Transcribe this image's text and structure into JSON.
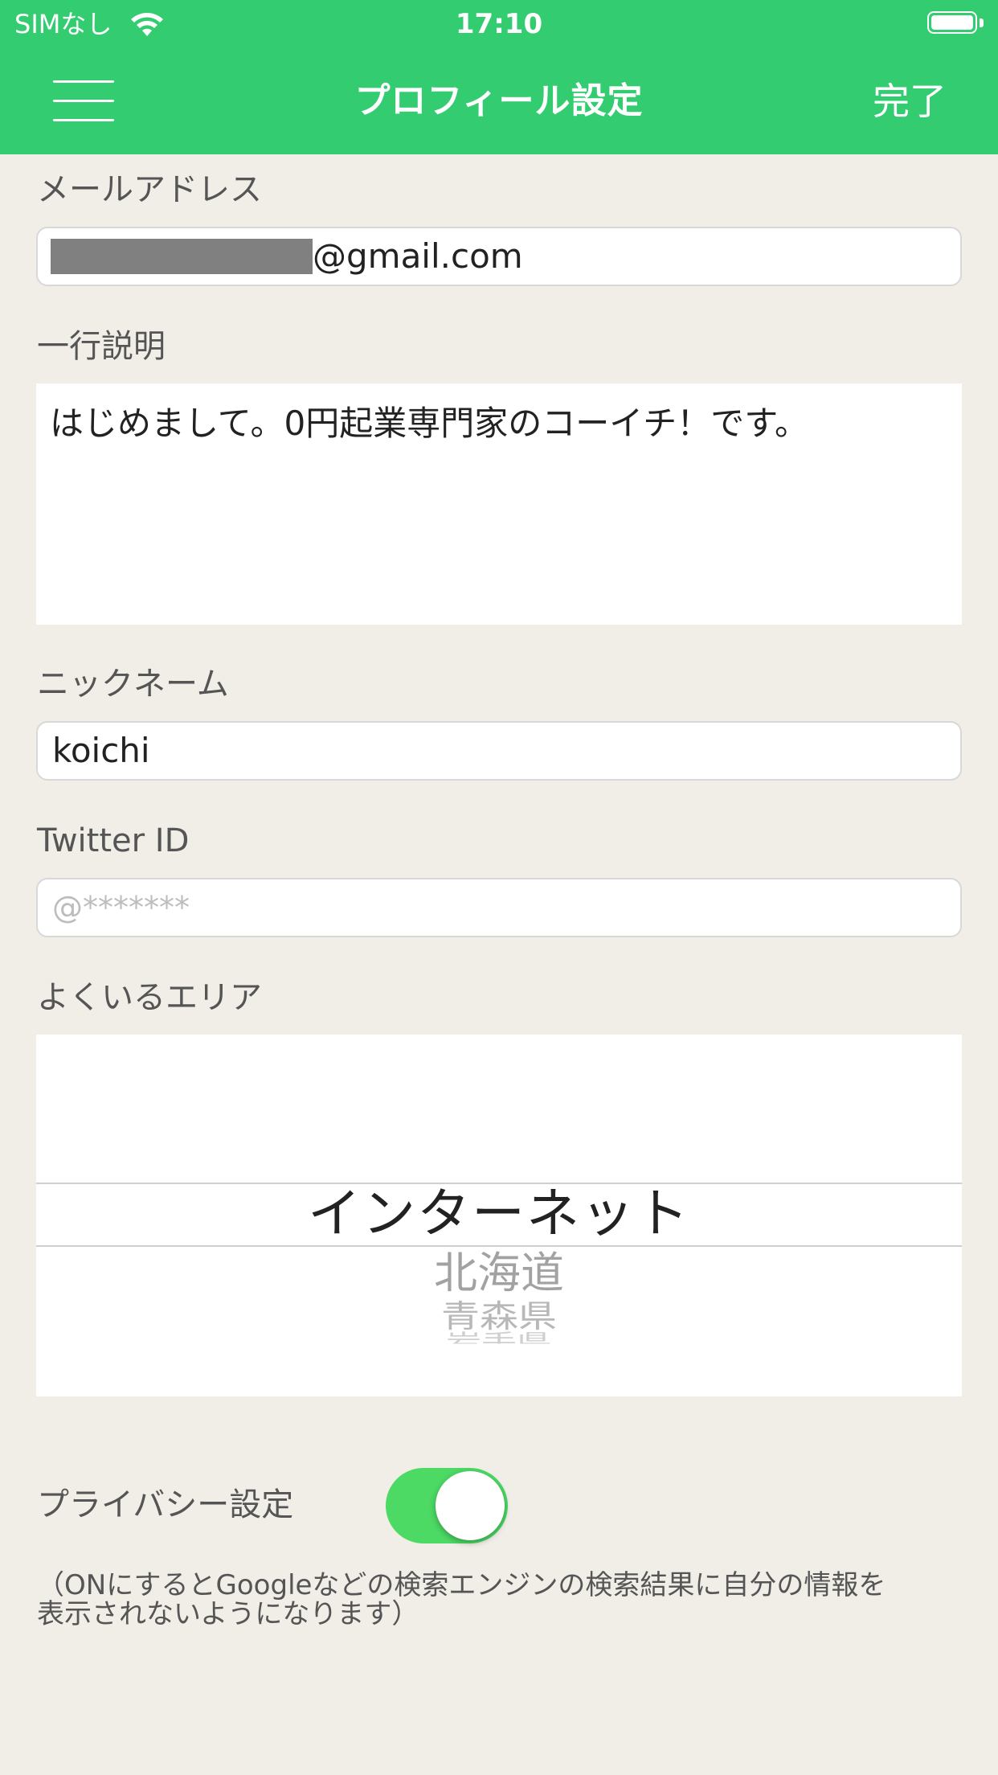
{
  "status_bar": {
    "carrier": "SIMなし",
    "time": "17:10"
  },
  "nav": {
    "title": "プロフィール設定",
    "done_label": "完了"
  },
  "form": {
    "email": {
      "label": "メールアドレス",
      "value_suffix": "@gmail.com"
    },
    "description": {
      "label": "一行説明",
      "value": "はじめまして。0円起業専門家のコーイチ！です。"
    },
    "nickname": {
      "label": "ニックネーム",
      "value": "koichi"
    },
    "twitter": {
      "label": "Twitter ID",
      "placeholder": "@*******"
    },
    "area": {
      "label": "よくいるエリア",
      "selected": "インターネット",
      "options_below": [
        "北海道",
        "青森県",
        "岩手県"
      ]
    },
    "privacy": {
      "label": "プライバシー設定",
      "enabled": true,
      "note_line1": "（ONにするとGoogleなどの検索エンジンの検索結果に自分の情報を",
      "note_line2": "表示されないようになります）"
    }
  },
  "colors": {
    "nav_green": "#33cc70",
    "toggle_green": "#4cd964",
    "background": "#f1eee8"
  }
}
